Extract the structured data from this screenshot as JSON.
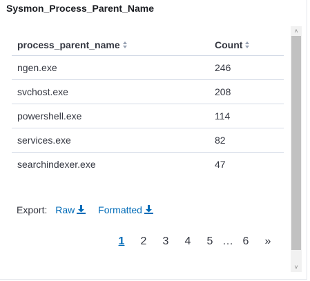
{
  "panel": {
    "title": "Sysmon_Process_Parent_Name"
  },
  "table": {
    "columns": [
      "process_parent_name",
      "Count"
    ],
    "rows": [
      {
        "process_parent_name": "ngen.exe",
        "count": "246"
      },
      {
        "process_parent_name": "svchost.exe",
        "count": "208"
      },
      {
        "process_parent_name": "powershell.exe",
        "count": "114"
      },
      {
        "process_parent_name": "services.exe",
        "count": "82"
      },
      {
        "process_parent_name": "searchindexer.exe",
        "count": "47"
      }
    ]
  },
  "export": {
    "label": "Export:",
    "raw": "Raw",
    "formatted": "Formatted"
  },
  "pagination": {
    "pages": [
      "1",
      "2",
      "3",
      "4",
      "5",
      "…",
      "6"
    ],
    "current": "1",
    "next": "»"
  },
  "colors": {
    "link": "#006bb8",
    "text": "#343741",
    "border": "#d3dae6"
  }
}
